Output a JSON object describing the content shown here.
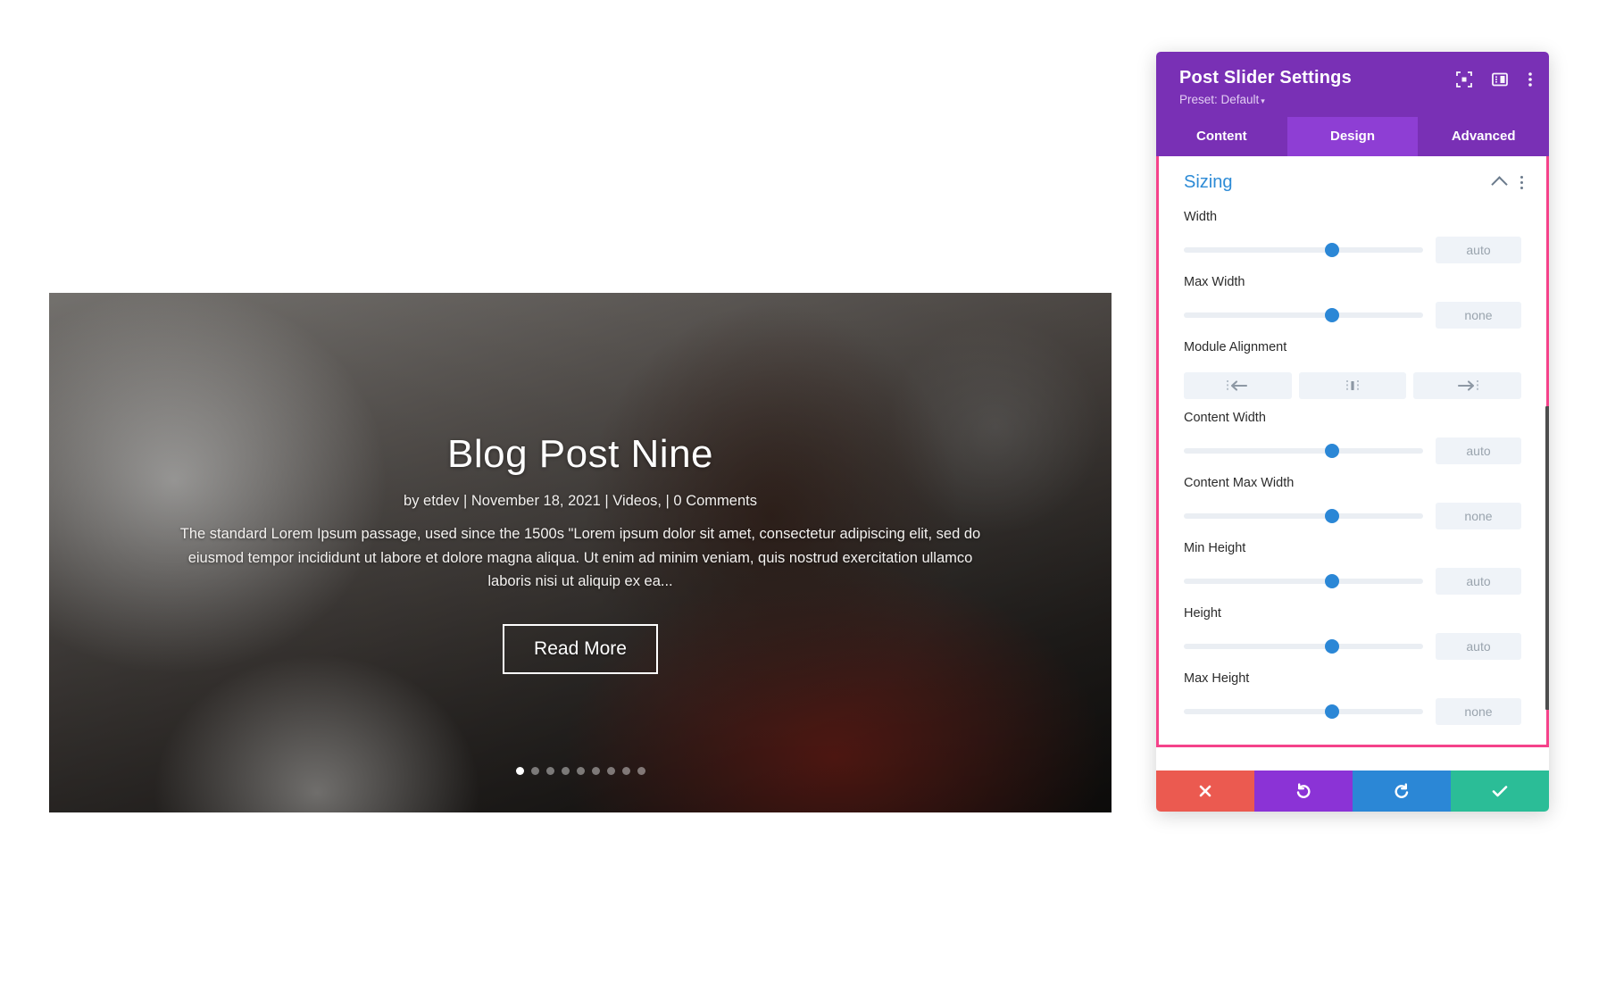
{
  "slider": {
    "title": "Blog Post Nine",
    "meta": "by etdev | November 18, 2021 | Videos, | 0 Comments",
    "body": "The standard Lorem Ipsum passage, used since the 1500s \"Lorem ipsum dolor sit amet, consectetur adipiscing elit, sed do eiusmod tempor incididunt ut labore et dolore magna aliqua. Ut enim ad minim veniam, quis nostrud exercitation ullamco laboris nisi ut aliquip ex ea...",
    "read_more_label": "Read More",
    "dots_count": 9,
    "active_dot_index": 0
  },
  "panel": {
    "title": "Post Slider Settings",
    "preset_label": "Preset: Default",
    "preset_caret": "▾",
    "header_icons": [
      {
        "name": "focus-target-icon"
      },
      {
        "name": "layout-panel-icon"
      },
      {
        "name": "kebab-menu-icon"
      }
    ],
    "tabs": [
      {
        "label": "Content",
        "active": false
      },
      {
        "label": "Design",
        "active": true
      },
      {
        "label": "Advanced",
        "active": false
      }
    ],
    "section": {
      "title": "Sizing",
      "collapse_icon": "chevron-up-icon",
      "options_icon": "kebab-menu-icon"
    },
    "fields": [
      {
        "label": "Width",
        "value": "auto",
        "knob_percent": 62
      },
      {
        "label": "Max Width",
        "value": "none",
        "knob_percent": 62
      },
      {
        "label": "Content Width",
        "value": "auto",
        "knob_percent": 62
      },
      {
        "label": "Content Max Width",
        "value": "none",
        "knob_percent": 62
      },
      {
        "label": "Min Height",
        "value": "auto",
        "knob_percent": 62
      },
      {
        "label": "Height",
        "value": "auto",
        "knob_percent": 62
      },
      {
        "label": "Max Height",
        "value": "none",
        "knob_percent": 62
      }
    ],
    "module_alignment": {
      "label": "Module Alignment",
      "options": [
        {
          "name": "align-left-icon"
        },
        {
          "name": "align-center-icon"
        },
        {
          "name": "align-right-icon"
        }
      ]
    },
    "footer": [
      {
        "name": "cancel-button",
        "icon": "close-icon",
        "color": "#eb5a50"
      },
      {
        "name": "undo-button",
        "icon": "undo-icon",
        "color": "#8b33d6"
      },
      {
        "name": "redo-button",
        "icon": "redo-icon",
        "color": "#2b87d6"
      },
      {
        "name": "save-button",
        "icon": "check-icon",
        "color": "#2bbd97"
      }
    ]
  },
  "colors": {
    "panel_header": "#7930b5",
    "tab_active": "#8e3ed4",
    "panel_border": "#f5428a",
    "section_title": "#2d8bd6",
    "slider_knob": "#2b87d6"
  }
}
